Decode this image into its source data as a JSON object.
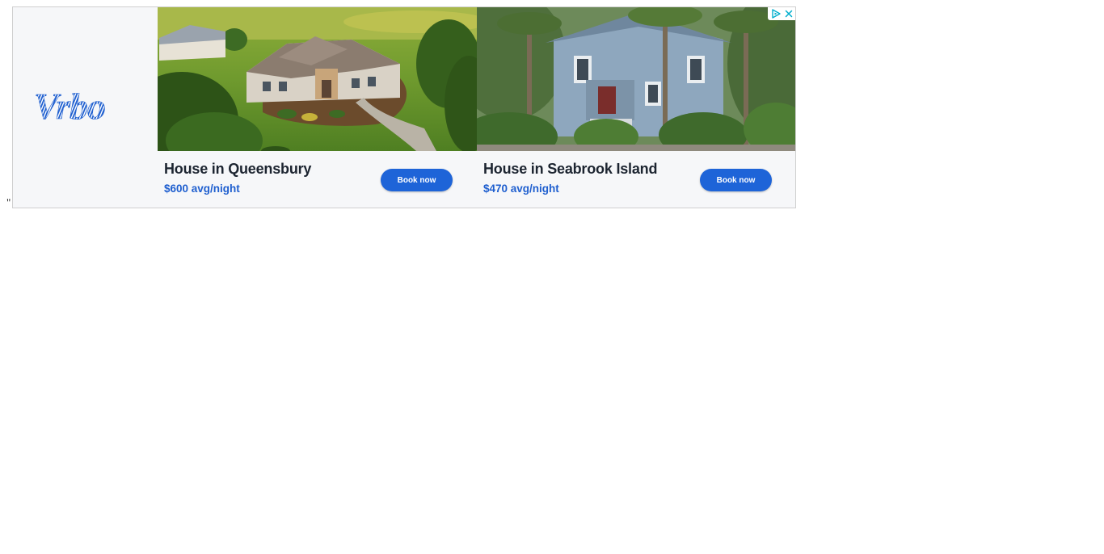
{
  "stray_text": "\"",
  "brand": {
    "name": "Vrbo",
    "logo_color": "#1f5fcf"
  },
  "listings": [
    {
      "title": "House in Queensbury",
      "price": "$600 avg/night",
      "button_label": "Book now",
      "photo": "aerial-view-large-house-green-lawn"
    },
    {
      "title": "House in Seabrook Island",
      "price": "$470 avg/night",
      "button_label": "Book now",
      "photo": "blue-coastal-house-with-palm-trees"
    }
  ],
  "adchoices": {
    "icon": "adchoices-icon",
    "close_icon": "close-icon",
    "color": "#00aecd"
  },
  "colors": {
    "accent": "#1e64d8",
    "price": "#1f5fcf",
    "title": "#1c2430",
    "panel_bg": "#f6f7f9"
  }
}
